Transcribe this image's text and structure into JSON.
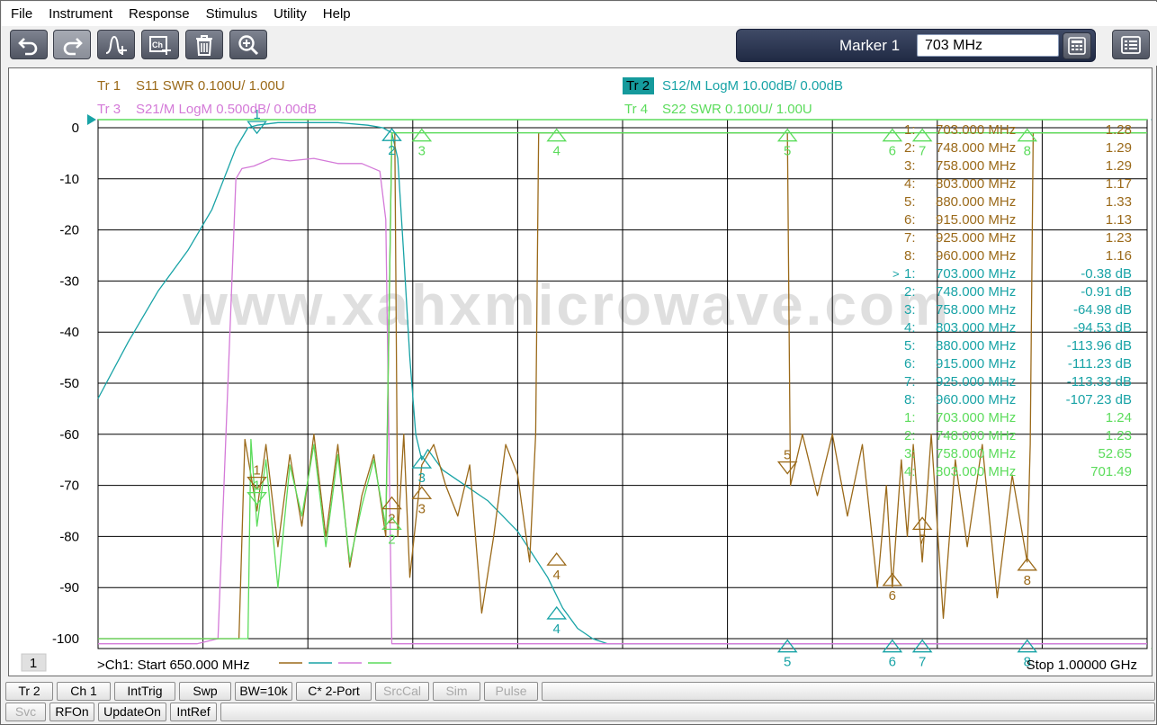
{
  "menu": [
    "File",
    "Instrument",
    "Response",
    "Stimulus",
    "Utility",
    "Help"
  ],
  "toolbar": {
    "buttons": [
      {
        "name": "undo-button",
        "icon": "undo-icon",
        "disabled": false
      },
      {
        "name": "redo-button",
        "icon": "redo-icon",
        "disabled": true
      },
      {
        "name": "add-marker-button",
        "icon": "marker-add-icon",
        "disabled": false
      },
      {
        "name": "add-channel-button",
        "icon": "channel-add-icon",
        "disabled": false
      },
      {
        "name": "delete-button",
        "icon": "trash-icon",
        "disabled": false
      },
      {
        "name": "zoom-button",
        "icon": "zoom-icon",
        "disabled": false
      }
    ],
    "marker_label": "Marker 1",
    "marker_value": "703 MHz"
  },
  "colors": {
    "tr1": "#9b6a1a",
    "tr2": "#18a3a6",
    "tr3": "#d47ad8",
    "tr4": "#5cdc5c",
    "grid": "#000000"
  },
  "traces": {
    "tr1": {
      "id": "Tr  1",
      "desc": "S11 SWR 0.100U/  1.00U"
    },
    "tr2": {
      "id": "Tr  2",
      "desc": "S12/M LogM 10.00dB/  0.00dB"
    },
    "tr3": {
      "id": "Tr  3",
      "desc": "S21/M LogM 0.500dB/  0.00dB"
    },
    "tr4": {
      "id": "Tr  4",
      "desc": "S22 SWR 0.100U/  1.00U"
    }
  },
  "watermark": "www.xahxmicrowave.com",
  "channel_number": "1",
  "start_label": ">Ch1:  Start   650.000 MHz",
  "stop_label": "Stop  1.00000 GHz",
  "marker_table": [
    {
      "t": "tr1",
      "n": "1:",
      "f": "703.000  MHz",
      "v": "1.28",
      "active": false
    },
    {
      "t": "tr1",
      "n": "2:",
      "f": "748.000  MHz",
      "v": "1.29",
      "active": false
    },
    {
      "t": "tr1",
      "n": "3:",
      "f": "758.000  MHz",
      "v": "1.29",
      "active": false
    },
    {
      "t": "tr1",
      "n": "4:",
      "f": "803.000  MHz",
      "v": "1.17",
      "active": false
    },
    {
      "t": "tr1",
      "n": "5:",
      "f": "880.000  MHz",
      "v": "1.33",
      "active": false
    },
    {
      "t": "tr1",
      "n": "6:",
      "f": "915.000  MHz",
      "v": "1.13",
      "active": false
    },
    {
      "t": "tr1",
      "n": "7:",
      "f": "925.000  MHz",
      "v": "1.23",
      "active": false
    },
    {
      "t": "tr1",
      "n": "8:",
      "f": "960.000  MHz",
      "v": "1.16",
      "active": false
    },
    {
      "t": "tr2",
      "n": "1:",
      "f": "703.000  MHz",
      "v": "-0.38 dB",
      "active": true
    },
    {
      "t": "tr2",
      "n": "2:",
      "f": "748.000  MHz",
      "v": "-0.91 dB",
      "active": false
    },
    {
      "t": "tr2",
      "n": "3:",
      "f": "758.000  MHz",
      "v": "-64.98 dB",
      "active": false
    },
    {
      "t": "tr2",
      "n": "4:",
      "f": "803.000  MHz",
      "v": "-94.53 dB",
      "active": false
    },
    {
      "t": "tr2",
      "n": "5:",
      "f": "880.000  MHz",
      "v": "-113.96 dB",
      "active": false
    },
    {
      "t": "tr2",
      "n": "6:",
      "f": "915.000  MHz",
      "v": "-111.23 dB",
      "active": false
    },
    {
      "t": "tr2",
      "n": "7:",
      "f": "925.000  MHz",
      "v": "-113.33 dB",
      "active": false
    },
    {
      "t": "tr2",
      "n": "8:",
      "f": "960.000  MHz",
      "v": "-107.23 dB",
      "active": false
    },
    {
      "t": "tr4",
      "n": "1:",
      "f": "703.000  MHz",
      "v": "1.24",
      "active": false
    },
    {
      "t": "tr4",
      "n": "2:",
      "f": "748.000  MHz",
      "v": "1.23",
      "active": false
    },
    {
      "t": "tr4",
      "n": "3:",
      "f": "758.000  MHz",
      "v": "52.65",
      "active": false
    },
    {
      "t": "tr4",
      "n": "4:",
      "f": "803.000  MHz",
      "v": "701.49",
      "active": false
    }
  ],
  "status_row1": [
    {
      "label": "Tr 2",
      "dim": false
    },
    {
      "label": "Ch 1",
      "dim": false
    },
    {
      "label": "IntTrig",
      "dim": false
    },
    {
      "label": "Swp",
      "dim": false
    },
    {
      "label": "BW=10k",
      "dim": false
    },
    {
      "label": "C* 2-Port",
      "dim": false
    },
    {
      "label": "SrcCal",
      "dim": true
    },
    {
      "label": "Sim",
      "dim": true
    },
    {
      "label": "Pulse",
      "dim": true
    }
  ],
  "status_row2": [
    {
      "label": "Svc",
      "dim": true
    },
    {
      "label": "RFOn",
      "dim": false
    },
    {
      "label": "UpdateOn",
      "dim": false
    },
    {
      "label": "IntRef",
      "dim": false
    }
  ],
  "chart_data": {
    "type": "line",
    "xlim": [
      650,
      1000
    ],
    "ylim": [
      -100,
      0
    ],
    "yticks": [
      0,
      -10,
      -20,
      -30,
      -40,
      -50,
      -60,
      -70,
      -80,
      -90,
      -100
    ],
    "ytick_labels": [
      "0",
      "-10",
      "-20",
      "-30",
      "-40",
      "-50",
      "-60",
      "-70",
      "-80",
      "-90",
      "-100"
    ],
    "series": [
      {
        "name": "Tr 2 S12/M LogM",
        "color_key": "tr2",
        "x": [
          650,
          660,
          670,
          680,
          688,
          692,
          696,
          700,
          703,
          710,
          720,
          730,
          740,
          745,
          748,
          750,
          752,
          754,
          756,
          758,
          760,
          765,
          770,
          780,
          790,
          800,
          805,
          810,
          815,
          820,
          830,
          840,
          880,
          915,
          925,
          960,
          1000
        ],
        "y": [
          -53,
          -42,
          -32,
          -24,
          -16,
          -10,
          -4,
          0,
          0.5,
          1,
          1,
          1,
          0.5,
          0,
          -1,
          -6,
          -25,
          -45,
          -60,
          -65,
          -63,
          -67,
          -69,
          -73,
          -79,
          -88,
          -94,
          -98,
          -100,
          -101,
          -101,
          -101,
          -101,
          -101,
          -101,
          -101,
          -101
        ]
      },
      {
        "name": "Tr 3 S21/M LogM",
        "color_key": "tr3",
        "x": [
          650,
          683,
          690,
          696,
          698,
          702,
          708,
          714,
          722,
          730,
          738,
          744,
          746,
          748,
          752,
          1000
        ],
        "y": [
          -101,
          -101,
          -100,
          -10,
          -8,
          -7.5,
          -6,
          -6.5,
          -6,
          -7,
          -7,
          -8.5,
          -18,
          -101,
          -101,
          -101
        ]
      },
      {
        "name": "Tr 1 S11 SWR",
        "color_key": "tr1",
        "x": [
          650,
          697,
          699,
          703,
          706,
          710,
          714,
          718,
          722,
          726,
          730,
          734,
          738,
          742,
          746,
          748,
          749,
          750,
          752,
          754,
          758,
          762,
          766,
          770,
          774,
          778,
          782,
          786,
          790,
          794,
          796,
          797,
          803,
          880,
          881,
          885,
          890,
          895,
          900,
          905,
          910,
          913,
          915,
          918,
          920,
          922,
          925,
          928,
          932,
          936,
          940,
          945,
          950,
          955,
          960,
          961,
          962,
          1000
        ],
        "y": [
          -100,
          -100,
          -61,
          -75,
          -62,
          -82,
          -64,
          -78,
          -60,
          -80,
          -62,
          -86,
          -72,
          -64,
          -80,
          -1,
          -1,
          -80,
          -60,
          -88,
          -66,
          -62,
          -70,
          -76,
          -66,
          -95,
          -80,
          -62,
          -68,
          -85,
          -60,
          -1,
          -1,
          -1,
          -70,
          -60,
          -72,
          -60,
          -76,
          -62,
          -90,
          -70,
          -90,
          -65,
          -80,
          -62,
          -85,
          -60,
          -96,
          -65,
          -82,
          -62,
          -92,
          -68,
          -85,
          -62,
          -1,
          -1
        ]
      },
      {
        "name": "Tr 4 S22 SWR",
        "color_key": "tr4",
        "x": [
          650,
          700,
          701,
          703,
          706,
          710,
          714,
          718,
          722,
          726,
          730,
          734,
          738,
          742,
          746,
          748,
          749,
          750,
          1000
        ],
        "y": [
          -100,
          -100,
          -61,
          -78,
          -65,
          -90,
          -66,
          -76,
          -62,
          -82,
          -64,
          -85,
          -74,
          -65,
          -78,
          -1,
          -1,
          -1,
          -1
        ]
      }
    ],
    "markers": [
      {
        "trace": "tr2",
        "label": "1",
        "x": 703,
        "y": -0.38,
        "side": "top"
      },
      {
        "trace": "tr2",
        "label": "2",
        "x": 748,
        "y": -0.91,
        "side": "bottom"
      },
      {
        "trace": "tr2",
        "label": "3",
        "x": 758,
        "y": -64.98,
        "side": "bottom"
      },
      {
        "trace": "tr2",
        "label": "4",
        "x": 803,
        "y": -94.53,
        "side": "bottom"
      },
      {
        "trace": "tr1",
        "label": "1",
        "x": 703,
        "y": -70,
        "side": "top"
      },
      {
        "trace": "tr1",
        "label": "2",
        "x": 748,
        "y": -73,
        "side": "bottom"
      },
      {
        "trace": "tr1",
        "label": "3",
        "x": 758,
        "y": -71,
        "side": "bottom"
      },
      {
        "trace": "tr1",
        "label": "4",
        "x": 803,
        "y": -84,
        "side": "bottom"
      },
      {
        "trace": "tr1",
        "label": "5",
        "x": 880,
        "y": -67,
        "side": "top"
      },
      {
        "trace": "tr1",
        "label": "6",
        "x": 915,
        "y": -88,
        "side": "bottom"
      },
      {
        "trace": "tr1",
        "label": "7",
        "x": 925,
        "y": -77,
        "side": "bottom"
      },
      {
        "trace": "tr1",
        "label": "8",
        "x": 960,
        "y": -85,
        "side": "bottom"
      },
      {
        "trace": "tr4",
        "label": "1",
        "x": 703,
        "y": -73,
        "side": "top"
      },
      {
        "trace": "tr4",
        "label": "2",
        "x": 748,
        "y": -77,
        "side": "bottom"
      },
      {
        "trace": "tr4",
        "label": "3",
        "x": 758,
        "y": -1,
        "side": "bottom"
      },
      {
        "trace": "tr4",
        "label": "4",
        "x": 803,
        "y": -1,
        "side": "bottom"
      },
      {
        "trace": "tr4",
        "label": "5",
        "x": 880,
        "y": -1,
        "side": "bottom"
      },
      {
        "trace": "tr4",
        "label": "6",
        "x": 915,
        "y": -1,
        "side": "bottom"
      },
      {
        "trace": "tr4",
        "label": "7",
        "x": 925,
        "y": -1,
        "side": "bottom"
      },
      {
        "trace": "tr4",
        "label": "8",
        "x": 960,
        "y": -1,
        "side": "bottom"
      },
      {
        "trace": "tr2",
        "label": "5",
        "x": 880,
        "y": -101,
        "side": "bottom"
      },
      {
        "trace": "tr2",
        "label": "6",
        "x": 915,
        "y": -101,
        "side": "bottom"
      },
      {
        "trace": "tr2",
        "label": "7",
        "x": 925,
        "y": -101,
        "side": "bottom"
      },
      {
        "trace": "tr2",
        "label": "8",
        "x": 960,
        "y": -101,
        "side": "bottom"
      }
    ]
  }
}
